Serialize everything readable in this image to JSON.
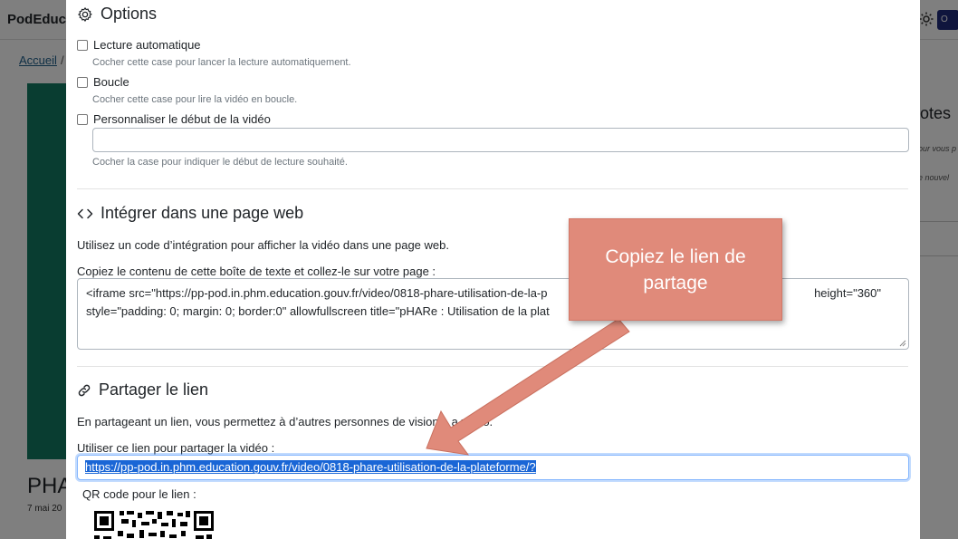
{
  "background": {
    "brand": "PodEduc",
    "breadcrumb_home": "Accueil",
    "breadcrumb_sep": "/",
    "video_title_fragment": "PHA",
    "date_fragment": "7 mai 20",
    "notes_title_fragment": "otes",
    "notes_text_1": "our vous p",
    "notes_text_2": "e nouvel",
    "user_badge": "O"
  },
  "options": {
    "title": "Options",
    "autoplay_label": "Lecture automatique",
    "autoplay_help": "Cocher cette case pour lancer la lecture automatiquement.",
    "loop_label": "Boucle",
    "loop_help": "Cocher cette case pour lire la vidéo en boucle.",
    "start_label": "Personnaliser le début de la vidéo",
    "start_value": "",
    "start_help": "Cocher la case pour indiquer le début de lecture souhaité."
  },
  "embed": {
    "title": "Intégrer dans une page web",
    "description": "Utilisez un code d’intégration pour afficher la vidéo dans une page web.",
    "instruction": "Copiez le contenu de cette boîte de texte et collez-le sur votre page :",
    "code_line_1": "<iframe src=\"https://pp-pod.in.phm.education.gouv.fr/video/0818-phare-utilisation-de-la-p",
    "code_line_1_end": "height=\"360\"",
    "code_line_2": "style=\"padding: 0; margin: 0; border:0\" allowfullscreen title=\"pHARe : Utilisation de la plat"
  },
  "share": {
    "title": "Partager le lien",
    "description_start": "En partageant un lien, vous permettez à d’autres personnes de vision",
    "description_end": "a vidéo.",
    "link_label": "Utiliser ce lien pour partager la vidéo :",
    "link_value": "https://pp-pod.in.phm.education.gouv.fr/video/0818-phare-utilisation-de-la-plateforme/?",
    "qr_label": "QR code pour le lien :"
  },
  "callout": {
    "text": "Copiez le lien de partage"
  },
  "colors": {
    "accent": "#e08a7a",
    "video_bg": "#137a63",
    "selection": "#1a66d6"
  }
}
